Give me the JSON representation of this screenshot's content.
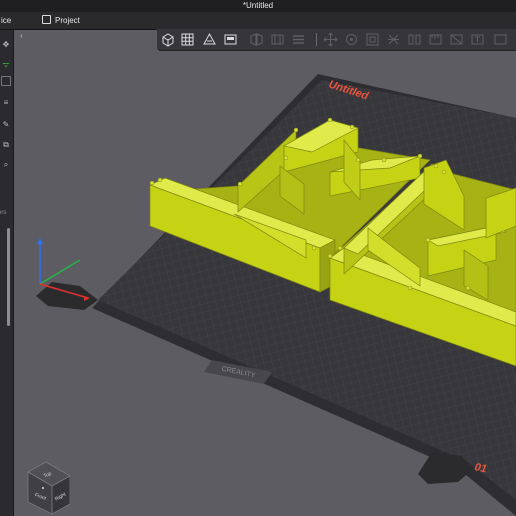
{
  "window": {
    "title": "*Untitled"
  },
  "menubar": {
    "device_label": "ice",
    "project_label": "Project"
  },
  "sidebar": {
    "tools": [
      {
        "icon": "move-icon"
      },
      {
        "icon": "wifi-icon"
      },
      {
        "icon": "cube-outline-icon"
      },
      {
        "icon": "sliders-icon"
      },
      {
        "icon": "edit-icon"
      },
      {
        "icon": "layers-icon"
      },
      {
        "icon": "search-icon"
      }
    ],
    "section_label": "ers"
  },
  "toolbar": {
    "buttons": [
      "add-object-icon",
      "arrange-grid-icon",
      "orient-icon",
      "lay-on-face-icon",
      "split-icon",
      "support-icon",
      "layers-icon",
      "move-icon",
      "rotate-icon",
      "scale-icon",
      "cut-icon",
      "mirror-icon",
      "measure-icon",
      "seam-icon",
      "text-icon"
    ]
  },
  "bed": {
    "plate_name": "Untitled",
    "plate_number": "01",
    "brand_text": "CREALITY"
  },
  "viewcube": {
    "top": "Top",
    "front": "Front",
    "right": "Right"
  },
  "colors": {
    "accent": "#e8553d",
    "model": "#c6d315",
    "bed": "#38383c",
    "background": "#5c5c62",
    "active_tool": "#40c040"
  }
}
